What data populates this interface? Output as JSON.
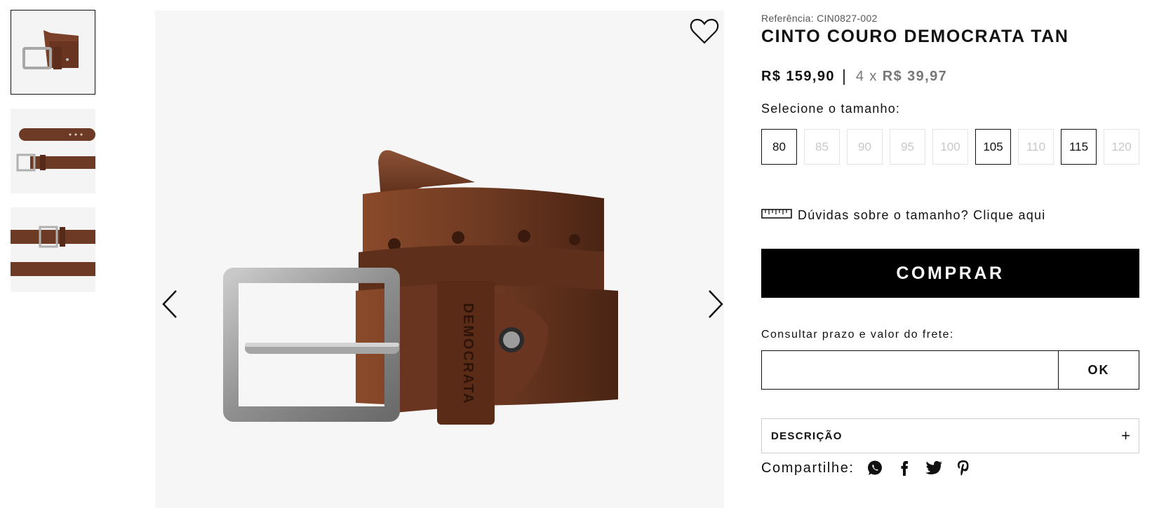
{
  "gallery": {
    "thumbnails": [
      {
        "name": "thumb-rolled-belt",
        "active": true
      },
      {
        "name": "thumb-belt-front-back",
        "active": false
      },
      {
        "name": "thumb-belt-detail",
        "active": false
      }
    ],
    "main_image_alt": "belt-image",
    "brand_embossed": "DEMOCRATA"
  },
  "product": {
    "reference": "Referência: CIN0827-002",
    "title": "CINTO COURO DEMOCRATA TAN",
    "price": "R$ 159,90",
    "installments_count": "4 x",
    "installment_price": "R$ 39,97"
  },
  "sizes": {
    "label": "Selecione o tamanho:",
    "options": [
      {
        "value": "80",
        "available": true
      },
      {
        "value": "85",
        "available": false
      },
      {
        "value": "90",
        "available": false
      },
      {
        "value": "95",
        "available": false
      },
      {
        "value": "100",
        "available": false
      },
      {
        "value": "105",
        "available": true
      },
      {
        "value": "110",
        "available": false
      },
      {
        "value": "115",
        "available": true
      },
      {
        "value": "120",
        "available": false
      }
    ],
    "help_text": "Dúvidas sobre o tamanho? Clique aqui"
  },
  "buy_button": "COMPRAR",
  "shipping": {
    "label": "Consultar prazo e valor do frete:",
    "input_value": "",
    "button": "OK"
  },
  "description": {
    "label": "DESCRIÇÃO",
    "toggle": "+"
  },
  "share": {
    "label": "Compartilhe:",
    "icons": [
      "whatsapp-icon",
      "facebook-icon",
      "twitter-icon",
      "pinterest-icon"
    ]
  },
  "colors": {
    "leather": "#6e3a22",
    "buckle": "#9a9a9a",
    "button_bg": "#000000",
    "gallery_bg": "#f6f6f6"
  }
}
